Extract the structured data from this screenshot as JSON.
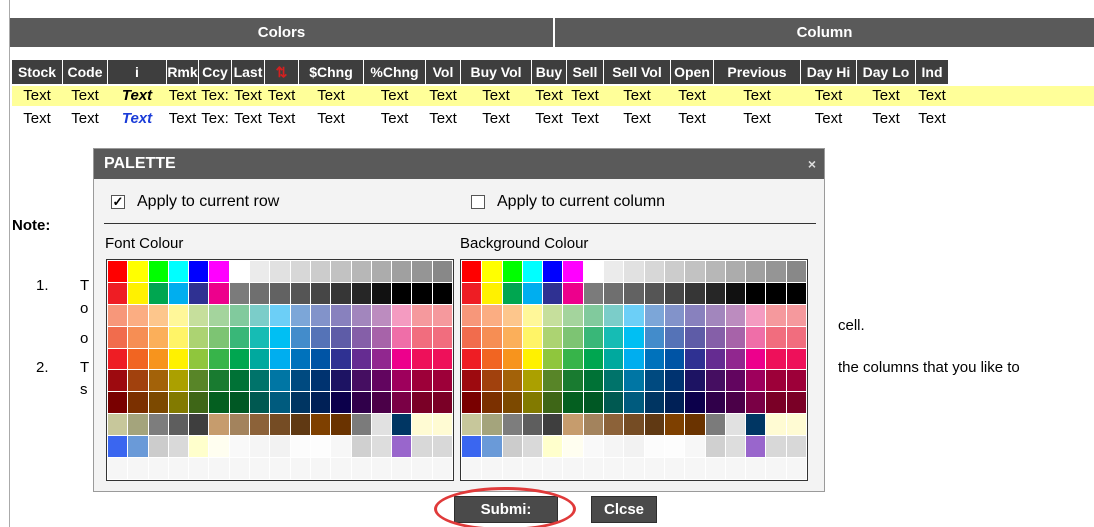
{
  "sections": {
    "colors": "Colors",
    "column": "Column"
  },
  "columns": [
    "Stock",
    "Code",
    "i",
    "Rmk",
    "Ccy",
    "Last",
    "⇅",
    "$Chng",
    "%Chng",
    "Vol",
    "Buy Vol",
    "Buy",
    "Sell",
    "Sell Vol",
    "Open",
    "Previous",
    "Day Hi",
    "Day Lo",
    "Ind"
  ],
  "rows": [
    {
      "cells": [
        "Text",
        "Text",
        "Text",
        "Text",
        "Tex:",
        "Text",
        "Text",
        "Text",
        "Text",
        "Text",
        "Text",
        "Text",
        "Text",
        "Text",
        "Text",
        "Text",
        "Text",
        "Text",
        "Text"
      ]
    },
    {
      "cells": [
        "Text",
        "Text",
        "Text",
        "Text",
        "Tex:",
        "Text",
        "Text",
        "Text",
        "Text",
        "Text",
        "Text",
        "Text",
        "Text",
        "Text",
        "Text",
        "Text",
        "Text",
        "Text",
        "Text"
      ]
    }
  ],
  "note": {
    "label": "Note:",
    "n1": "1.",
    "n2": "2.",
    "t1": "T",
    "c1": "o",
    "c2": "o",
    "t2": "T",
    "s2": "s",
    "right1": "cell.",
    "right2": "the columns that you like to"
  },
  "palette": {
    "title": "PALETTE",
    "close_glyph": "×",
    "apply_row": "Apply to current row",
    "apply_row_checked": true,
    "apply_column": "Apply to current column",
    "apply_column_checked": false,
    "font_label": "Font Colour",
    "bg_label": "Background Colour",
    "swatches": [
      [
        "#ff0000",
        "#ffff00",
        "#00ff00",
        "#00ffff",
        "#0000ff",
        "#ff00ff",
        "#ffffff",
        "#ebebeb",
        "#e1e1e1",
        "#d7d7d7",
        "#cccccc",
        "#c2c2c2",
        "#b7b7b7",
        "#acacac",
        "#a0a0a0",
        "#959595",
        "#888888"
      ],
      [
        "#ee1d24",
        "#fff100",
        "#00a650",
        "#00aeef",
        "#2f3192",
        "#ed008c",
        "#7b7b7b",
        "#6f6f6f",
        "#626262",
        "#555555",
        "#464646",
        "#363636",
        "#262626",
        "#111111",
        "#000000",
        "#000000",
        "#000000"
      ],
      [
        "#f7977a",
        "#fbad82",
        "#fdc68c",
        "#fff799",
        "#c6df9c",
        "#a4d49d",
        "#81ca9d",
        "#7bcdc9",
        "#6ccff7",
        "#7ca6d8",
        "#8293ca",
        "#8881be",
        "#a286bd",
        "#bc8cbf",
        "#f49bc1",
        "#f5999d",
        "#f5999d"
      ],
      [
        "#f16c4d",
        "#f68e54",
        "#fbaf5a",
        "#fff467",
        "#acd372",
        "#7dc473",
        "#39b778",
        "#16bcb4",
        "#00bff3",
        "#438ccb",
        "#5573b7",
        "#5e5ca7",
        "#855fa8",
        "#a763a9",
        "#ef6ea8",
        "#f16d7e",
        "#f16d7e"
      ],
      [
        "#ee1d24",
        "#f16522",
        "#f7941d",
        "#fff100",
        "#8fc63d",
        "#37b44a",
        "#00a650",
        "#00a99e",
        "#00aeef",
        "#0072bc",
        "#0054a5",
        "#2f3192",
        "#652c91",
        "#91278f",
        "#ed008c",
        "#ee105a",
        "#ee105a"
      ],
      [
        "#9d0a0f",
        "#a1410d",
        "#a36209",
        "#aba000",
        "#588528",
        "#197b30",
        "#007236",
        "#00736a",
        "#0076a4",
        "#004a80",
        "#003370",
        "#1d1363",
        "#450e61",
        "#62055f",
        "#9e005c",
        "#9d0039",
        "#9d0039"
      ],
      [
        "#790000",
        "#7b3000",
        "#7c4900",
        "#827a00",
        "#3e6617",
        "#045f20",
        "#005824",
        "#005951",
        "#005b7e",
        "#003562",
        "#002056",
        "#0c004b",
        "#30004a",
        "#4b0048",
        "#7a0045",
        "#7a0026",
        "#7a0026"
      ],
      [
        "#c7c79b",
        "#a4a47c",
        "#7d7d7d",
        "#5e5e5e",
        "#3e3e3e",
        "#c69c6d",
        "#a3835d",
        "#8c6239",
        "#754c24",
        "#603913",
        "#7e4000",
        "#6a3300",
        "#7b7b7b",
        "#e1e1e1",
        "#003663",
        "#fffbd3",
        "#fffbd3"
      ],
      [
        "#3a66f0",
        "#6a9ad8",
        "#cccccc",
        "#d9d9d9",
        "#ffffcc",
        "#fffef0",
        "#f9f9f9",
        "#f5f5f5",
        "#f2f2f2",
        "#fcfcfc",
        "#fdfdfd",
        "#f7f7f7",
        "#d0d0d0",
        "#dddddd",
        "#9966cc",
        "#d8d8d8",
        "#d8d8d8"
      ],
      [
        "#f6f6f6",
        "#f6f6f6",
        "#f6f6f6",
        "#f6f6f6",
        "#f6f6f6",
        "#f6f6f6",
        "#f6f6f6",
        "#f6f6f6",
        "#f6f6f6",
        "#f6f6f6",
        "#f6f6f6",
        "#f6f6f6",
        "#f6f6f6",
        "#f6f6f6",
        "#f6f6f6",
        "#f6f6f6",
        "#f6f6f6"
      ]
    ]
  },
  "buttons": {
    "submit": "Submi:",
    "close": "Clcse"
  },
  "colors": {
    "row_highlight": "#ffff99",
    "header_bg": "#3e3e3e",
    "section_bg": "#5a5a5a",
    "link_blue": "#1a3cd8",
    "highlight_ring": "#e03a3a"
  }
}
